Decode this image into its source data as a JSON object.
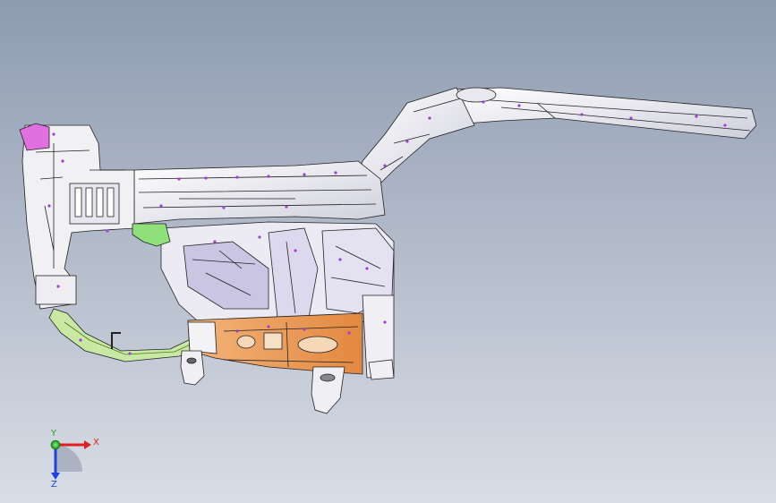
{
  "viewport": {
    "background_top": "#8e9bb0",
    "background_bottom": "#d9dde6"
  },
  "model": {
    "parts": [
      {
        "name": "main-rail",
        "color": "#f4f4f7"
      },
      {
        "name": "front-mount-bracket",
        "color": "#f1f1f4"
      },
      {
        "name": "lower-reinforcement-plate",
        "color": "#e8924a"
      },
      {
        "name": "lower-cross-tube",
        "color": "#b8e08c"
      },
      {
        "name": "shock-tower",
        "color": "#d9d6ea"
      },
      {
        "name": "upper-cap",
        "color": "#e070e0"
      },
      {
        "name": "green-bracket",
        "color": "#8fe07a"
      }
    ],
    "weld_point_color": "#a040d0"
  },
  "triad": {
    "x_label": "X",
    "y_label": "Y",
    "z_label": "Z",
    "x_color": "#e02020",
    "y_color": "#20c020",
    "z_color": "#2040e0"
  }
}
